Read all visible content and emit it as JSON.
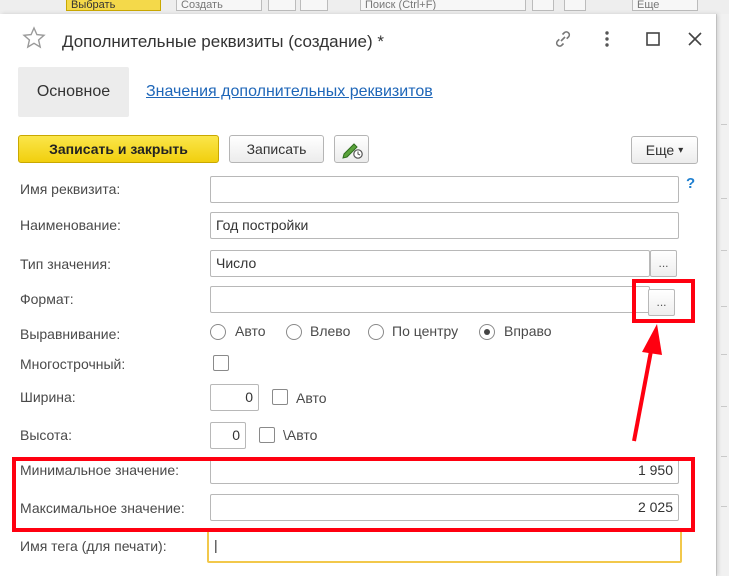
{
  "background": {
    "toolbar_items": [
      "Выбрать",
      "Создать",
      "Поиск (Ctrl+F)",
      "Еще"
    ]
  },
  "window": {
    "title": "Дополнительные реквизиты (создание) *",
    "icons": [
      "star-icon",
      "link-icon",
      "kebab-menu-icon",
      "maximize-icon",
      "close-icon"
    ]
  },
  "tabs": {
    "main": "Основное",
    "values_link": "Значения дополнительных реквизитов"
  },
  "toolbar": {
    "save_close": "Записать и закрыть",
    "save": "Записать",
    "more": "Еще",
    "more_arrow": "▾",
    "edit_icon": "pencil-clock-icon"
  },
  "form": {
    "name_label": "Имя реквизита:",
    "name_value": "",
    "help": "?",
    "title_label": "Наименование:",
    "title_value": "Год постройки",
    "type_label": "Тип значения:",
    "type_value": "Число",
    "format_label": "Формат:",
    "format_value": "",
    "dots": "...",
    "align_label": "Выравнивание:",
    "align_options": [
      "Авто",
      "Влево",
      "По центру",
      "Вправо"
    ],
    "align_selected": "Вправо",
    "multiline_label": "Многострочный:",
    "width_label": "Ширина:",
    "width_value": "0",
    "width_auto": "Авто",
    "height_label": "Высота:",
    "height_value": "0",
    "height_auto": "\\Авто",
    "min_label": "Минимальное значение:",
    "min_value": "1 950",
    "max_label": "Максимальное значение:",
    "max_value": "2 025",
    "tag_label": "Имя тега (для печати):",
    "tag_value": "|"
  },
  "annotation": {
    "color": "#ff0010"
  }
}
